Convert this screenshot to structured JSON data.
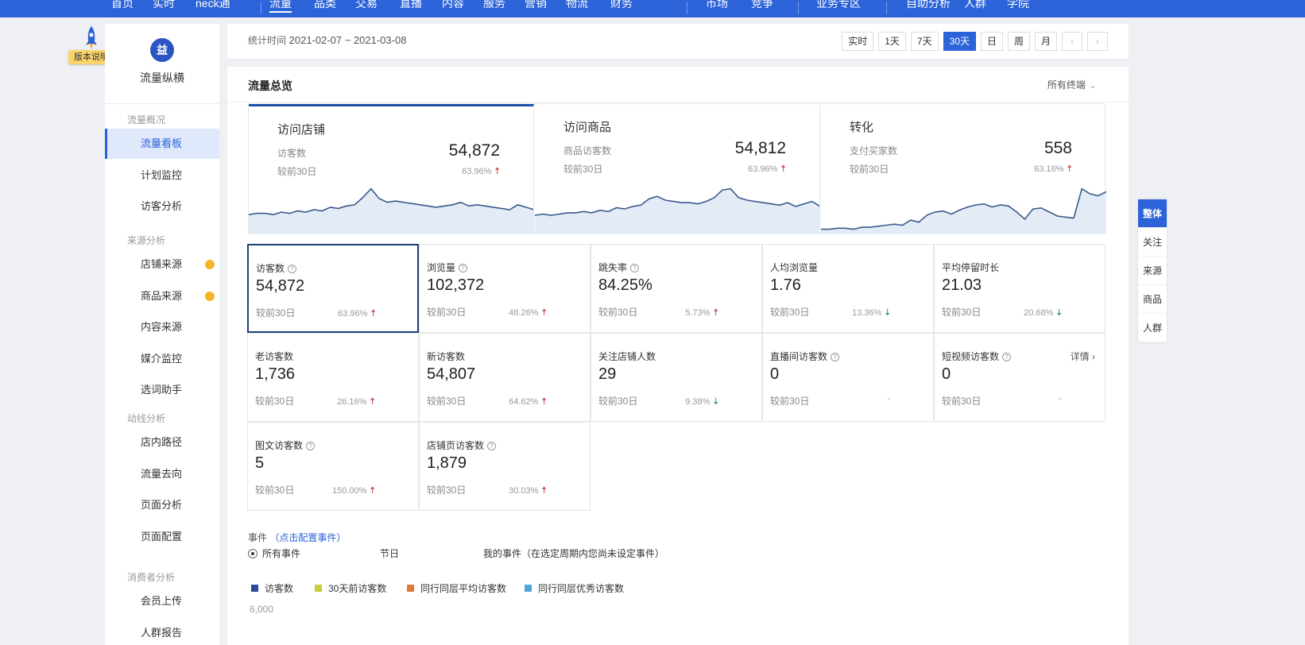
{
  "topnav": {
    "items": [
      "首页",
      "实时",
      "neck通",
      "流量",
      "品类",
      "交易",
      "直播",
      "内容",
      "服务",
      "营销",
      "物流",
      "财务",
      "市场",
      "竞争",
      "业务专区",
      "自助分析",
      "人群",
      "学院"
    ],
    "active_index": 3
  },
  "badge": {
    "label": "版本说明"
  },
  "sidebar": {
    "logo_text": "益",
    "title": "流量纵横",
    "groups": [
      {
        "label": "流量概况",
        "items": [
          "流量看板",
          "计划监控",
          "访客分析"
        ]
      },
      {
        "label": "来源分析",
        "items": [
          "店铺来源",
          "商品来源",
          "内容来源",
          "媒介监控",
          "选词助手"
        ]
      },
      {
        "label": "动线分析",
        "items": [
          "店内路径",
          "流量去向",
          "页面分析",
          "页面配置"
        ]
      },
      {
        "label": "消费者分析",
        "items": [
          "会员上传",
          "人群报告"
        ]
      }
    ],
    "active_item": "流量看板"
  },
  "header": {
    "stat_label": "统计时间",
    "stat_range": "2021-02-07 ~ 2021-03-08",
    "periods": [
      "实时",
      "1天",
      "7天",
      "30天",
      "日",
      "周",
      "月"
    ],
    "active_period": "30天",
    "prev": "‹",
    "next": "›"
  },
  "panel": {
    "title": "流量总览",
    "terminal": "所有终端",
    "terminal_chevron": "⌄"
  },
  "summary": [
    {
      "title": "访问店铺",
      "label": "访客数",
      "compare": "较前30日",
      "value": "54,872",
      "pct": "63.96%",
      "trend": "up",
      "spark": [
        16,
        17,
        17,
        16,
        18,
        17,
        19,
        18,
        20,
        19,
        22,
        21,
        23,
        24,
        30,
        37,
        29,
        26,
        27,
        26,
        25,
        24,
        23,
        22,
        23,
        24,
        26,
        23,
        24,
        23,
        22,
        21,
        20,
        24,
        22,
        20
      ]
    },
    {
      "title": "访问商品",
      "label": "商品访客数",
      "compare": "较前30日",
      "value": "54,812",
      "pct": "63.96%",
      "trend": "up",
      "spark": [
        15,
        16,
        15,
        16,
        17,
        17,
        18,
        17,
        19,
        18,
        21,
        20,
        22,
        23,
        28,
        30,
        27,
        26,
        25,
        25,
        24,
        26,
        29,
        35,
        36,
        29,
        27,
        26,
        25,
        24,
        23,
        25,
        22,
        24,
        26,
        22
      ]
    },
    {
      "title": "转化",
      "label": "支付买家数",
      "compare": "较前30日",
      "value": "558",
      "pct": "63.16%",
      "trend": "up",
      "spark": [
        5,
        5,
        6,
        6,
        5,
        7,
        7,
        8,
        9,
        10,
        9,
        14,
        12,
        19,
        22,
        23,
        20,
        24,
        27,
        29,
        30,
        27,
        29,
        28,
        22,
        15,
        25,
        26,
        22,
        18,
        17,
        16,
        45,
        40,
        38,
        42
      ]
    }
  ],
  "metrics": [
    {
      "label": "访客数",
      "help": true,
      "value": "54,872",
      "compare": "较前30日",
      "pct": "63.96%",
      "trend": "up"
    },
    {
      "label": "浏览量",
      "help": true,
      "value": "102,372",
      "compare": "较前30日",
      "pct": "48.26%",
      "trend": "up"
    },
    {
      "label": "跳失率",
      "help": true,
      "value": "84.25%",
      "compare": "较前30日",
      "pct": "5.73%",
      "trend": "up"
    },
    {
      "label": "人均浏览量",
      "help": false,
      "value": "1.76",
      "compare": "较前30日",
      "pct": "13.36%",
      "trend": "down"
    },
    {
      "label": "平均停留时长",
      "help": false,
      "value": "21.03",
      "compare": "较前30日",
      "pct": "20.68%",
      "trend": "down"
    },
    {
      "label": "老访客数",
      "help": false,
      "value": "1,736",
      "compare": "较前30日",
      "pct": "26.16%",
      "trend": "up"
    },
    {
      "label": "新访客数",
      "help": false,
      "value": "54,807",
      "compare": "较前30日",
      "pct": "64.62%",
      "trend": "up"
    },
    {
      "label": "关注店铺人数",
      "help": false,
      "value": "29",
      "compare": "较前30日",
      "pct": "9.38%",
      "trend": "down"
    },
    {
      "label": "直播间访客数",
      "help": true,
      "value": "0",
      "compare": "较前30日",
      "pct": "-",
      "trend": "none"
    },
    {
      "label": "短视频访客数",
      "help": true,
      "value": "0",
      "compare": "较前30日",
      "pct": "-",
      "trend": "none",
      "detail": "详情 ›"
    },
    {
      "label": "图文访客数",
      "help": true,
      "value": "5",
      "compare": "较前30日",
      "pct": "150.00%",
      "trend": "up"
    },
    {
      "label": "店铺页访客数",
      "help": true,
      "value": "1,879",
      "compare": "较前30日",
      "pct": "30.03%",
      "trend": "up"
    }
  ],
  "events": {
    "label": "事件",
    "link": "（点击配置事件）",
    "options": [
      "所有事件",
      "节日",
      "我的事件（在选定周期内您尚未设定事件）"
    ],
    "selected": "所有事件"
  },
  "legend": [
    {
      "label": "访客数",
      "color": "#2b4c9b"
    },
    {
      "label": "30天前访客数",
      "color": "#c9cf3a"
    },
    {
      "label": "同行同层平均访客数",
      "color": "#e07b3a"
    },
    {
      "label": "同行同层优秀访客数",
      "color": "#4ea6d8"
    }
  ],
  "yaxis": {
    "top_label": "6,000"
  },
  "right_tabs": [
    "整体",
    "关注",
    "来源",
    "商品",
    "人群"
  ],
  "right_tabs_active": "整体",
  "colors": {
    "primary": "#2c63d8",
    "up": "#d04b4b",
    "down": "#25a36a",
    "spark_fill": "#e3ebf7",
    "spark_line": "#3a5a8c"
  }
}
